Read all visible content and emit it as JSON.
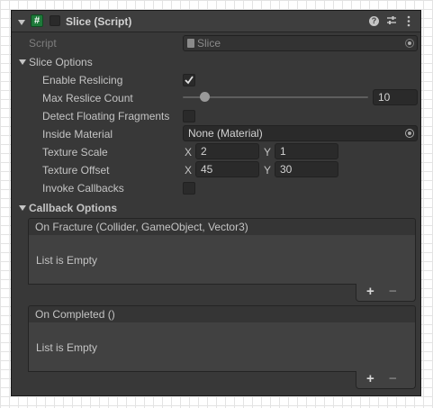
{
  "component": {
    "title": "Slice (Script)",
    "header_icons": [
      "fold-arrow-icon",
      "script-icon",
      "help-icon",
      "presets-icon",
      "more-icon"
    ]
  },
  "script_field": {
    "label": "Script",
    "value": "Slice"
  },
  "slice_options": {
    "title": "Slice Options",
    "enable_reslicing": {
      "label": "Enable Reslicing",
      "checked": true
    },
    "max_reslice_count": {
      "label": "Max Reslice Count",
      "value": "10",
      "slider_fraction": 0.12
    },
    "detect_floating_fragments": {
      "label": "Detect Floating Fragments",
      "checked": false
    },
    "inside_material": {
      "label": "Inside Material",
      "value": "None (Material)"
    },
    "texture_scale": {
      "label": "Texture Scale",
      "x_label": "X",
      "x": "2",
      "y_label": "Y",
      "y": "1"
    },
    "texture_offset": {
      "label": "Texture Offset",
      "x_label": "X",
      "x": "45",
      "y_label": "Y",
      "y": "30"
    },
    "invoke_callbacks": {
      "label": "Invoke Callbacks",
      "checked": false
    }
  },
  "callback_options": {
    "title": "Callback Options",
    "on_fracture": {
      "header": "On Fracture (Collider, GameObject, Vector3)",
      "empty_text": "List is Empty",
      "add": "+",
      "remove": "−"
    },
    "on_completed": {
      "header": "On Completed ()",
      "empty_text": "List is Empty",
      "add": "+",
      "remove": "−"
    }
  },
  "colors": {
    "panel": "#383838",
    "field": "#2a2a2a",
    "text": "#c4c4c4",
    "checkmark": "#e0e0e0"
  }
}
